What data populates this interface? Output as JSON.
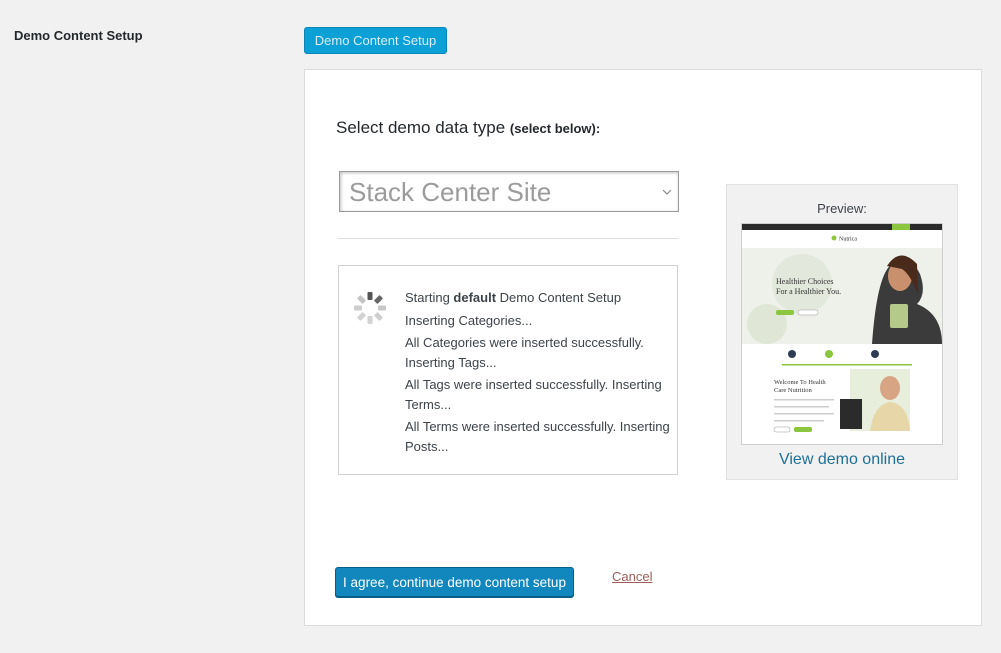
{
  "row_label": "Demo Content Setup",
  "top_button_label": "Demo Content Setup",
  "select_section": {
    "title": "Select demo data type",
    "title_hint": "(select below):",
    "selected_value": "Stack Center Site"
  },
  "log": {
    "starting_prefix": "Starting ",
    "starting_bold": "default",
    "starting_suffix": " Demo Content Setup",
    "lines": [
      "Inserting Categories...",
      "All Categories were inserted successfully. Inserting Tags...",
      "All Tags were inserted successfully. Inserting Terms...",
      "All Terms were inserted successfully. Inserting Posts..."
    ]
  },
  "preview": {
    "label": "Preview:",
    "thumb_logo": "Nutrica",
    "thumb_headline_1": "Healthier Choices",
    "thumb_headline_2": "For a Healthier You.",
    "thumb_welcome_1": "Welcome To Health",
    "thumb_welcome_2": "Care Nutrition",
    "view_link": "View demo online"
  },
  "actions": {
    "agree_label": "I agree, continue demo content setup",
    "cancel_label": "Cancel"
  },
  "colors": {
    "primary_button": "#1187bd",
    "top_button": "#0ba0d6",
    "link": "#1f6f98",
    "cancel_link": "#a05d58",
    "accent_green": "#8cc63f"
  },
  "icons": {
    "spinner": "loading-spinner-icon",
    "select_arrow": "chevron-down-icon"
  }
}
